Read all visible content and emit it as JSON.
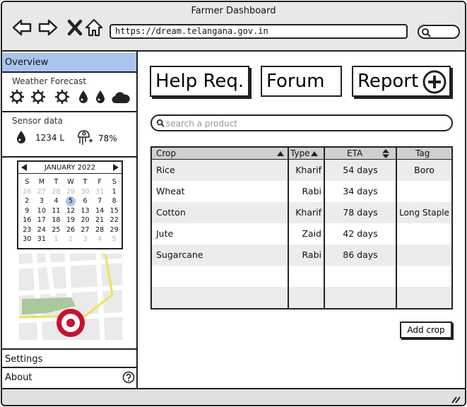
{
  "window": {
    "title": "Farmer Dashboard"
  },
  "browser": {
    "url": "https://dream.telangana.gov.in"
  },
  "sidebar": {
    "overview_label": "Overview",
    "weather": {
      "label": "Weather Forecast",
      "icons": [
        "sun-icon",
        "sun-icon",
        "sun-icon",
        "drop-icon",
        "drop-icon",
        "cloud-icon"
      ]
    },
    "sensor": {
      "label": "Sensor data",
      "water_value": "1234 L",
      "humidity_value": "78%"
    },
    "calendar": {
      "month_label": "JANUARY 2022",
      "weekdays": [
        "S",
        "M",
        "T",
        "W",
        "T",
        "F",
        "S"
      ],
      "weeks": [
        [
          "26",
          "27",
          "28",
          "29",
          "30",
          "31",
          "1"
        ],
        [
          "2",
          "3",
          "4",
          "5",
          "6",
          "7",
          "8"
        ],
        [
          "9",
          "10",
          "11",
          "12",
          "13",
          "14",
          "15"
        ],
        [
          "16",
          "17",
          "18",
          "19",
          "20",
          "21",
          "22"
        ],
        [
          "23",
          "24",
          "25",
          "26",
          "27",
          "28",
          "29"
        ],
        [
          "30",
          "31",
          "1",
          "2",
          "3",
          "4",
          "5"
        ]
      ],
      "selected_day": "5"
    },
    "settings_label": "Settings",
    "about_label": "About"
  },
  "main": {
    "help_label": "Help Req.",
    "forum_label": "Forum",
    "report_label": "Report",
    "search_placeholder": "search a product",
    "table": {
      "headers": {
        "crop": "Crop",
        "type": "Type",
        "eta": "ETA",
        "tag": "Tag"
      },
      "rows": [
        {
          "crop": "Rice",
          "type": "Kharif",
          "eta": "54 days",
          "tag": "Boro"
        },
        {
          "crop": "Wheat",
          "type": "Rabi",
          "eta": "34 days",
          "tag": ""
        },
        {
          "crop": "Cotton",
          "type": "Kharif",
          "eta": "78 days",
          "tag": "Long Staple"
        },
        {
          "crop": "Jute",
          "type": "Zaid",
          "eta": "42 days",
          "tag": ""
        },
        {
          "crop": "Sugarcane",
          "type": "Rabi",
          "eta": "86 days",
          "tag": ""
        }
      ]
    },
    "add_crop_label": "Add crop"
  },
  "colors": {
    "selected": "#a9c5ef",
    "map_target": "#c8102e",
    "map_park": "#a8c99a",
    "map_road": "#f0e05a"
  }
}
